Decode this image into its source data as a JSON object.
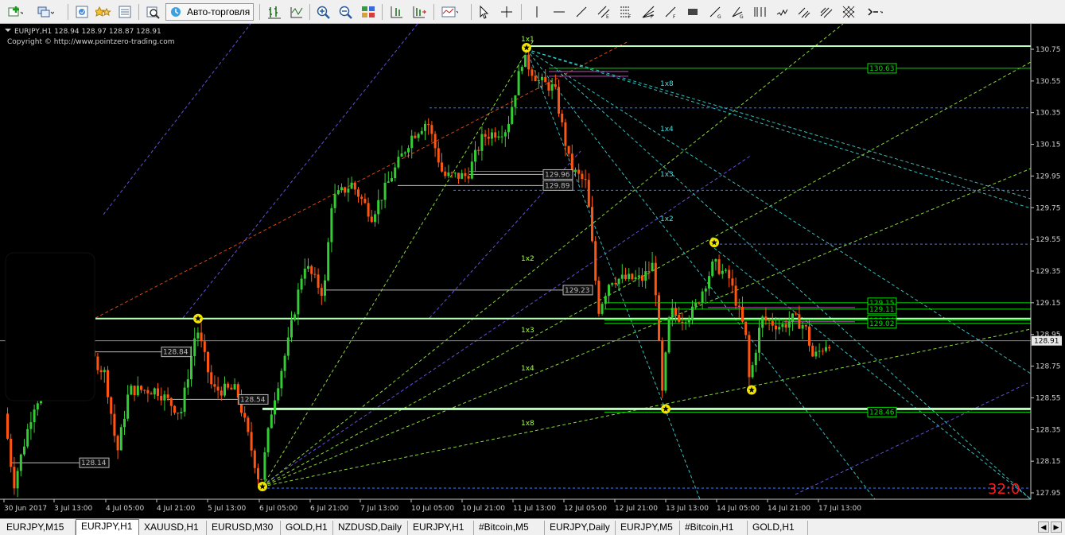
{
  "toolbar": {
    "auto_trading_label": "Авто-торговля"
  },
  "chart": {
    "header": "EURJPY,H1  128.94 128.97 128.87 128.91",
    "copyright": "Copyright © http://www.pointzero-trading.com",
    "current_price": "128.91",
    "counter": "32:0",
    "colors": {
      "bull": "#33cc33",
      "bear": "#ff5511",
      "background": "#000000",
      "text": "#d0d0d0"
    }
  },
  "chart_data": {
    "type": "candlestick",
    "symbol": "EURJPY",
    "timeframe": "H1",
    "ylim": [
      127.9,
      130.8
    ],
    "y_ticks": [
      "130.75",
      "130.55",
      "130.35",
      "130.15",
      "129.95",
      "129.75",
      "129.55",
      "129.35",
      "129.15",
      "128.95",
      "128.75",
      "128.55",
      "128.35",
      "128.15",
      "127.95"
    ],
    "x_ticks": [
      "30 Jun 2017",
      "3 Jul 13:00",
      "4 Jul 05:00",
      "4 Jul 21:00",
      "5 Jul 13:00",
      "6 Jul 05:00",
      "6 Jul 21:00",
      "7 Jul 13:00",
      "10 Jul 05:00",
      "10 Jul 21:00",
      "11 Jul 13:00",
      "12 Jul 05:00",
      "12 Jul 21:00",
      "13 Jul 13:00",
      "14 Jul 05:00",
      "14 Jul 21:00",
      "17 Jul 13:00"
    ],
    "levels": [
      {
        "price": 130.77,
        "color": "#b8ffb8",
        "width": 2,
        "style": "solid"
      },
      {
        "price": 130.63,
        "color": "#00dd00",
        "width": 1,
        "style": "solid",
        "label": "130.63"
      },
      {
        "price": 130.38,
        "color": "#3a7dff",
        "width": 1,
        "style": "dotted"
      },
      {
        "price": 129.86,
        "color": "#3a7dff",
        "width": 1,
        "style": "dotted"
      },
      {
        "price": 129.52,
        "color": "#3a7dff",
        "width": 1,
        "style": "dotted"
      },
      {
        "price": 129.15,
        "color": "#00dd00",
        "width": 1,
        "style": "solid",
        "label": "129.15"
      },
      {
        "price": 129.11,
        "color": "#00dd00",
        "width": 1,
        "style": "solid",
        "label": "129.11"
      },
      {
        "price": 129.05,
        "color": "#b8ffb8",
        "width": 2,
        "style": "solid"
      },
      {
        "price": 129.04,
        "color": "#00dd00",
        "width": 1,
        "style": "solid",
        "label": "129.04"
      },
      {
        "price": 129.02,
        "color": "#00dd00",
        "width": 1,
        "style": "solid",
        "label": "129.02"
      },
      {
        "price": 128.91,
        "color": "#8a8a8a",
        "width": 1,
        "style": "solid"
      },
      {
        "price": 128.48,
        "color": "#b8ffb8",
        "width": 3,
        "style": "solid"
      },
      {
        "price": 128.46,
        "color": "#00dd00",
        "width": 1,
        "style": "solid",
        "label": "128.46"
      },
      {
        "price": 127.98,
        "color": "#3a7dff",
        "width": 1,
        "style": "dotted"
      }
    ],
    "white_levels": [
      {
        "price": 129.96,
        "label": "129.96"
      },
      {
        "price": 129.89,
        "label": "129.89"
      },
      {
        "price": 129.23,
        "label": "129.23"
      },
      {
        "price": 128.84,
        "label": "128.84"
      },
      {
        "price": 128.54,
        "label": "128.54"
      },
      {
        "price": 128.14,
        "label": "128.14"
      }
    ],
    "gann_labels_upper": [
      "1x1",
      "1x8",
      "1x4",
      "1x3",
      "1x2"
    ],
    "gann_labels_lower": [
      "1x2",
      "1x3",
      "1x4",
      "1x8"
    ]
  },
  "tabs": [
    {
      "label": "EURJPY,M15",
      "active": false
    },
    {
      "label": "EURJPY,H1",
      "active": true
    },
    {
      "label": "XAUUSD,H1",
      "active": false
    },
    {
      "label": "EURUSD,M30",
      "active": false
    },
    {
      "label": "GOLD,H1",
      "active": false
    },
    {
      "label": "NZDUSD,Daily",
      "active": false
    },
    {
      "label": "EURJPY,H1",
      "active": false
    },
    {
      "label": "#Bitcoin,M5",
      "active": false
    },
    {
      "label": "EURJPY,Daily",
      "active": false
    },
    {
      "label": "EURJPY,M5",
      "active": false
    },
    {
      "label": "#Bitcoin,H1",
      "active": false
    },
    {
      "label": "GOLD,H1",
      "active": false
    }
  ]
}
